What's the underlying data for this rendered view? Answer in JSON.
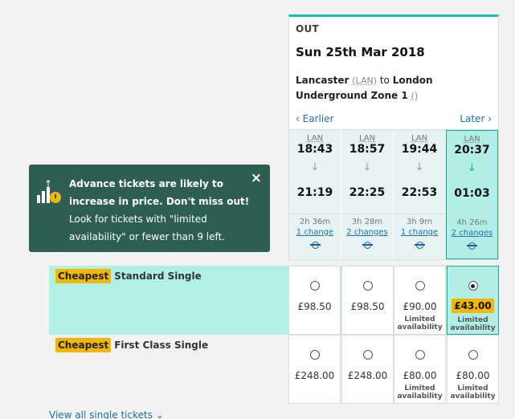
{
  "journey": {
    "direction": "OUT",
    "date": "Sun 25th Mar 2018",
    "origin": "Lancaster",
    "origin_code": "(LAN)",
    "to_word": "to",
    "destination": "London Underground Zone 1",
    "destination_code": "()",
    "earlier_label": "Earlier",
    "later_label": "Later"
  },
  "trains": [
    {
      "code": "LAN",
      "depart": "18:43",
      "arrive": "21:19",
      "duration": "2h 36m",
      "changes": "1 change"
    },
    {
      "code": "LAN",
      "depart": "18:57",
      "arrive": "22:25",
      "duration": "3h 28m",
      "changes": "2 changes"
    },
    {
      "code": "LAN",
      "depart": "19:44",
      "arrive": "22:53",
      "duration": "3h 9m",
      "changes": "1 change"
    },
    {
      "code": "LAN",
      "depart": "20:37",
      "arrive": "01:03",
      "duration": "4h 26m",
      "changes": "2 changes"
    }
  ],
  "tooltip": {
    "bold_text": "Advance tickets are likely to increase in price. Don't miss out!",
    "body_text": "Look for tickets with \"limited availability\" or fewer than 9 left.",
    "close_symbol": "×"
  },
  "fare_rows": [
    {
      "badge": "Cheapest",
      "name": "Standard Single",
      "fares": [
        {
          "price": "£98.50",
          "limited": ""
        },
        {
          "price": "£98.50",
          "limited": ""
        },
        {
          "price": "£90.00",
          "limited": "Limited availability"
        },
        {
          "price": "£43.00",
          "limited": "Limited availability"
        }
      ]
    },
    {
      "badge": "Cheapest",
      "name": "First Class Single",
      "fares": [
        {
          "price": "£248.00",
          "limited": ""
        },
        {
          "price": "£248.00",
          "limited": ""
        },
        {
          "price": "£80.00",
          "limited": "Limited availability"
        },
        {
          "price": "£80.00",
          "limited": "Limited availability"
        }
      ]
    }
  ],
  "view_all_label": "View all single tickets",
  "colors": {
    "accent": "#16c2b0",
    "selected_bg": "#b2eee6",
    "tooltip_bg": "#2e5d51",
    "badge": "#f2b705",
    "link": "#1a6fb0"
  },
  "icons": {
    "earlier": "chevron-left-icon",
    "later": "chevron-right-icon",
    "arrow": "arrow-down-icon",
    "tube": "underground-icon",
    "tip": "price-rise-icon",
    "close": "close-icon",
    "view_all": "chevron-down-icon"
  }
}
